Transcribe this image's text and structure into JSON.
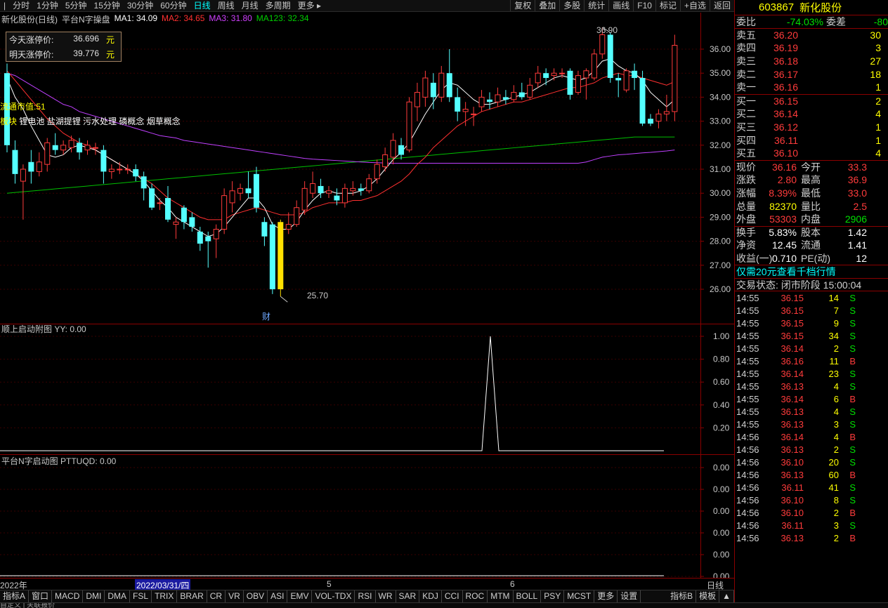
{
  "toolbar": {
    "left_items": [
      "分时",
      "1分钟",
      "5分钟",
      "15分钟",
      "30分钟",
      "60分钟",
      "日线",
      "周线",
      "月线",
      "多周期",
      "更多 ▸"
    ],
    "active_index": 6,
    "right_items": [
      "复权",
      "叠加",
      "多股",
      "统计",
      "画线",
      "F10",
      "标记",
      "+自选",
      "返回"
    ]
  },
  "legend": {
    "stock": "新化股份(日线)",
    "indicator": "平台N字操盘",
    "ma1": "MA1: 34.09",
    "ma2": "MA2: 34.65",
    "ma3": "MA3: 31.80",
    "ma123": "MA123: 32.34"
  },
  "limitbox": {
    "today_label": "今天涨停价:",
    "today_value": "36.696",
    "today_unit": "元",
    "tomorrow_label": "明天涨停价:",
    "tomorrow_value": "39.776",
    "tomorrow_unit": "元"
  },
  "overlay": {
    "market_cap": "流通市值:51",
    "sectors_label": "板块",
    "sectors": "锂电池 盐湖提锂 污水处理 磷概念 烟草概念",
    "high_label": "36.90",
    "low_label": "25.70",
    "cai_label": "财"
  },
  "main_axis": [
    "36.00",
    "35.00",
    "34.00",
    "33.00",
    "32.00",
    "31.00",
    "30.00",
    "29.00",
    "28.00",
    "27.00",
    "26.00"
  ],
  "sub1": {
    "title": "顺上启动附图 YY: 0.00",
    "axis": [
      "1.00",
      "0.80",
      "0.60",
      "0.40",
      "0.20"
    ]
  },
  "sub2": {
    "title": "平台N字启动图 PTTUQD: 0.00",
    "axis": [
      "0.00",
      "0.00",
      "0.00",
      "0.00",
      "0.00",
      "0.00"
    ]
  },
  "datebar": {
    "year": "2022年",
    "selected": "2022/03/31/四",
    "m5": "5",
    "m6": "6",
    "period": "日线"
  },
  "tabs": [
    "指标A",
    "窗口",
    "MACD",
    "DMI",
    "DMA",
    "FSL",
    "TRIX",
    "BRAR",
    "CR",
    "VR",
    "OBV",
    "ASI",
    "EMV",
    "VOL-TDX",
    "RSI",
    "WR",
    "SAR",
    "KDJ",
    "CCI",
    "ROC",
    "MTM",
    "BOLL",
    "PSY",
    "MCST",
    "更多",
    "设置"
  ],
  "tabs_right": [
    "指标B",
    "模板",
    "▲"
  ],
  "bottom_strip": "自定义 | 关联报价",
  "quote": {
    "code": "603867",
    "name": "新化股份",
    "wb_label": "委比",
    "wb_value": "-74.03%",
    "wc_label": "委差",
    "wc_value": "-80",
    "asks": [
      {
        "label": "卖五",
        "price": "36.20",
        "vol": "30"
      },
      {
        "label": "卖四",
        "price": "36.19",
        "vol": "3"
      },
      {
        "label": "卖三",
        "price": "36.18",
        "vol": "27"
      },
      {
        "label": "卖二",
        "price": "36.17",
        "vol": "18"
      },
      {
        "label": "卖一",
        "price": "36.16",
        "vol": "1"
      }
    ],
    "bids": [
      {
        "label": "买一",
        "price": "36.15",
        "vol": "2"
      },
      {
        "label": "买二",
        "price": "36.14",
        "vol": "4"
      },
      {
        "label": "买三",
        "price": "36.12",
        "vol": "1"
      },
      {
        "label": "买四",
        "price": "36.11",
        "vol": "1"
      },
      {
        "label": "买五",
        "price": "36.10",
        "vol": "4"
      }
    ],
    "stats": [
      {
        "l1": "现价",
        "v1": "36.16",
        "c1": "red",
        "l2": "今开",
        "v2": "33.3",
        "c2": "red"
      },
      {
        "l1": "涨跌",
        "v1": "2.80",
        "c1": "red",
        "l2": "最高",
        "v2": "36.9",
        "c2": "red"
      },
      {
        "l1": "涨幅",
        "v1": "8.39%",
        "c1": "red",
        "l2": "最低",
        "v2": "33.0",
        "c2": "red"
      },
      {
        "l1": "总量",
        "v1": "82370",
        "c1": "yellow",
        "l2": "量比",
        "v2": "2.5",
        "c2": "red"
      },
      {
        "l1": "外盘",
        "v1": "53303",
        "c1": "red",
        "l2": "内盘",
        "v2": "2906",
        "c2": "green"
      },
      {
        "l1": "换手",
        "v1": "5.83%",
        "c1": "white",
        "l2": "股本",
        "v2": "1.42",
        "c2": "white"
      },
      {
        "l1": "净资",
        "v1": "12.45",
        "c1": "white",
        "l2": "流通",
        "v2": "1.41",
        "c2": "white"
      },
      {
        "l1": "收益(一)",
        "v1": "0.710",
        "c1": "white",
        "l2": "PE(动)",
        "v2": "12",
        "c2": "white"
      }
    ],
    "promo": "仅需20元查看千档行情",
    "status": "交易状态: 闭市阶段 15:00:04",
    "ticks": [
      {
        "t": "14:55",
        "p": "36.15",
        "v": "14",
        "d": "S"
      },
      {
        "t": "14:55",
        "p": "36.15",
        "v": "7",
        "d": "S"
      },
      {
        "t": "14:55",
        "p": "36.15",
        "v": "9",
        "d": "S"
      },
      {
        "t": "14:55",
        "p": "36.15",
        "v": "34",
        "d": "S"
      },
      {
        "t": "14:55",
        "p": "36.14",
        "v": "2",
        "d": "S"
      },
      {
        "t": "14:55",
        "p": "36.16",
        "v": "11",
        "d": "B"
      },
      {
        "t": "14:55",
        "p": "36.14",
        "v": "23",
        "d": "S"
      },
      {
        "t": "14:55",
        "p": "36.13",
        "v": "4",
        "d": "S"
      },
      {
        "t": "14:55",
        "p": "36.14",
        "v": "6",
        "d": "B"
      },
      {
        "t": "14:55",
        "p": "36.13",
        "v": "4",
        "d": "S"
      },
      {
        "t": "14:55",
        "p": "36.13",
        "v": "3",
        "d": "S"
      },
      {
        "t": "14:56",
        "p": "36.14",
        "v": "4",
        "d": "B"
      },
      {
        "t": "14:56",
        "p": "36.13",
        "v": "2",
        "d": "S"
      },
      {
        "t": "14:56",
        "p": "36.10",
        "v": "20",
        "d": "S"
      },
      {
        "t": "14:56",
        "p": "36.13",
        "v": "60",
        "d": "B"
      },
      {
        "t": "14:56",
        "p": "36.11",
        "v": "41",
        "d": "S"
      },
      {
        "t": "14:56",
        "p": "36.10",
        "v": "8",
        "d": "S"
      },
      {
        "t": "14:56",
        "p": "36.10",
        "v": "2",
        "d": "B"
      },
      {
        "t": "14:56",
        "p": "36.11",
        "v": "3",
        "d": "S"
      },
      {
        "t": "14:56",
        "p": "36.13",
        "v": "2",
        "d": "B"
      }
    ]
  },
  "colors": {
    "up": "#ff3b3b",
    "down": "#54ffff",
    "ma1": "#ffffff",
    "ma2": "#ff3030",
    "ma3": "#c040ff",
    "ma123": "#00c000",
    "highlight": "#ffe000",
    "frame": "#8b0000"
  },
  "chart_data": {
    "type": "candlestick",
    "candles": [
      {
        "o": 35.0,
        "c": 32.0,
        "h": 35.4,
        "l": 31.7
      },
      {
        "o": 31.8,
        "c": 30.8,
        "h": 32.2,
        "l": 30.4
      },
      {
        "o": 30.5,
        "c": 31.0,
        "h": 31.2,
        "l": 28.9
      },
      {
        "o": 31.3,
        "c": 30.9,
        "h": 31.8,
        "l": 30.4
      },
      {
        "o": 30.9,
        "c": 31.3,
        "h": 31.7,
        "l": 30.7
      },
      {
        "o": 31.2,
        "c": 32.1,
        "h": 32.3,
        "l": 30.9
      },
      {
        "o": 32.0,
        "c": 31.8,
        "h": 32.5,
        "l": 31.6
      },
      {
        "o": 31.8,
        "c": 32.0,
        "h": 32.2,
        "l": 31.6
      },
      {
        "o": 31.9,
        "c": 32.2,
        "h": 32.4,
        "l": 31.7
      },
      {
        "o": 32.1,
        "c": 31.7,
        "h": 32.3,
        "l": 31.4
      },
      {
        "o": 31.8,
        "c": 32.0,
        "h": 32.2,
        "l": 31.6
      },
      {
        "o": 31.9,
        "c": 31.9,
        "h": 32.1,
        "l": 31.6
      },
      {
        "o": 31.8,
        "c": 30.9,
        "h": 32.0,
        "l": 30.4
      },
      {
        "o": 30.9,
        "c": 31.0,
        "h": 31.2,
        "l": 30.6
      },
      {
        "o": 31.0,
        "c": 31.0,
        "h": 31.3,
        "l": 30.8
      },
      {
        "o": 31.0,
        "c": 31.0,
        "h": 31.2,
        "l": 30.8
      },
      {
        "o": 31.0,
        "c": 30.7,
        "h": 31.2,
        "l": 30.5
      },
      {
        "o": 30.7,
        "c": 30.2,
        "h": 30.9,
        "l": 29.7
      },
      {
        "o": 30.2,
        "c": 29.4,
        "h": 30.4,
        "l": 29.3
      },
      {
        "o": 29.6,
        "c": 29.6,
        "h": 29.8,
        "l": 29.3
      },
      {
        "o": 29.8,
        "c": 28.9,
        "h": 30.3,
        "l": 28.8
      },
      {
        "o": 28.7,
        "c": 28.8,
        "h": 29.0,
        "l": 28.1
      },
      {
        "o": 29.4,
        "c": 28.8,
        "h": 29.5,
        "l": 28.5
      },
      {
        "o": 29.0,
        "c": 28.6,
        "h": 29.2,
        "l": 28.4
      },
      {
        "o": 28.4,
        "c": 27.9,
        "h": 28.6,
        "l": 27.6
      },
      {
        "o": 28.2,
        "c": 28.0,
        "h": 28.4,
        "l": 26.9
      },
      {
        "o": 28.1,
        "c": 28.5,
        "h": 28.7,
        "l": 27.3
      },
      {
        "o": 28.5,
        "c": 29.9,
        "h": 30.2,
        "l": 28.3
      },
      {
        "o": 29.6,
        "c": 30.1,
        "h": 30.5,
        "l": 29.2
      },
      {
        "o": 30.0,
        "c": 30.2,
        "h": 30.4,
        "l": 29.7
      },
      {
        "o": 30.2,
        "c": 30.0,
        "h": 30.9,
        "l": 29.8
      },
      {
        "o": 30.8,
        "c": 29.4,
        "h": 31.1,
        "l": 29.2
      },
      {
        "o": 28.8,
        "c": 28.2,
        "h": 29.0,
        "l": 27.8
      },
      {
        "o": 28.7,
        "c": 26.0,
        "h": 28.8,
        "l": 25.8
      },
      {
        "o": 26.0,
        "c": 28.8,
        "h": 28.9,
        "l": 25.7,
        "hl": true
      },
      {
        "o": 28.5,
        "c": 28.7,
        "h": 29.2,
        "l": 28.3
      },
      {
        "o": 28.7,
        "c": 29.4,
        "h": 29.7,
        "l": 28.6
      },
      {
        "o": 29.3,
        "c": 30.2,
        "h": 30.5,
        "l": 29.1
      },
      {
        "o": 30.0,
        "c": 30.4,
        "h": 30.9,
        "l": 29.8
      },
      {
        "o": 30.3,
        "c": 30.0,
        "h": 30.6,
        "l": 29.8
      },
      {
        "o": 30.0,
        "c": 30.1,
        "h": 30.3,
        "l": 29.8
      },
      {
        "o": 29.9,
        "c": 29.7,
        "h": 30.2,
        "l": 29.5
      },
      {
        "o": 29.6,
        "c": 30.2,
        "h": 30.4,
        "l": 29.4
      },
      {
        "o": 30.1,
        "c": 30.2,
        "h": 30.5,
        "l": 29.9
      },
      {
        "o": 30.2,
        "c": 30.1,
        "h": 30.4,
        "l": 29.9
      },
      {
        "o": 30.1,
        "c": 30.6,
        "h": 30.8,
        "l": 30.0
      },
      {
        "o": 30.6,
        "c": 31.2,
        "h": 31.4,
        "l": 30.4
      },
      {
        "o": 31.1,
        "c": 31.6,
        "h": 31.9,
        "l": 30.9
      },
      {
        "o": 31.5,
        "c": 32.2,
        "h": 32.5,
        "l": 31.2
      },
      {
        "o": 32.0,
        "c": 31.6,
        "h": 32.3,
        "l": 31.4
      },
      {
        "o": 31.8,
        "c": 33.8,
        "h": 34.0,
        "l": 31.7
      },
      {
        "o": 33.6,
        "c": 34.2,
        "h": 34.6,
        "l": 33.0
      },
      {
        "o": 34.0,
        "c": 34.8,
        "h": 35.1,
        "l": 33.6
      },
      {
        "o": 34.6,
        "c": 34.0,
        "h": 35.0,
        "l": 33.5
      },
      {
        "o": 34.0,
        "c": 35.0,
        "h": 35.3,
        "l": 33.8
      },
      {
        "o": 35.0,
        "c": 34.0,
        "h": 36.0,
        "l": 33.8
      },
      {
        "o": 34.0,
        "c": 33.4,
        "h": 34.4,
        "l": 33.0
      },
      {
        "o": 33.4,
        "c": 33.5,
        "h": 33.8,
        "l": 32.8
      },
      {
        "o": 33.3,
        "c": 33.3,
        "h": 33.6,
        "l": 32.8
      },
      {
        "o": 33.6,
        "c": 34.0,
        "h": 34.3,
        "l": 33.4
      },
      {
        "o": 33.9,
        "c": 33.8,
        "h": 34.2,
        "l": 33.5
      },
      {
        "o": 33.8,
        "c": 34.1,
        "h": 34.4,
        "l": 33.6
      },
      {
        "o": 34.0,
        "c": 33.9,
        "h": 34.3,
        "l": 33.7
      },
      {
        "o": 33.9,
        "c": 34.2,
        "h": 34.5,
        "l": 33.8
      },
      {
        "o": 34.2,
        "c": 34.0,
        "h": 34.6,
        "l": 33.9
      },
      {
        "o": 34.0,
        "c": 34.5,
        "h": 34.8,
        "l": 33.9
      },
      {
        "o": 34.6,
        "c": 35.0,
        "h": 35.3,
        "l": 34.4
      },
      {
        "o": 35.0,
        "c": 34.8,
        "h": 35.2,
        "l": 34.5
      },
      {
        "o": 34.9,
        "c": 35.0,
        "h": 35.2,
        "l": 34.7
      },
      {
        "o": 35.0,
        "c": 35.0,
        "h": 35.2,
        "l": 34.8
      },
      {
        "o": 35.1,
        "c": 34.1,
        "h": 35.2,
        "l": 33.9
      },
      {
        "o": 34.2,
        "c": 34.9,
        "h": 35.1,
        "l": 34.1
      },
      {
        "o": 34.8,
        "c": 35.1,
        "h": 35.2,
        "l": 33.9
      },
      {
        "o": 34.8,
        "c": 35.8,
        "h": 36.0,
        "l": 34.7
      },
      {
        "o": 35.8,
        "c": 36.6,
        "h": 36.9,
        "l": 35.6
      },
      {
        "o": 36.6,
        "c": 34.8,
        "h": 36.7,
        "l": 34.6
      },
      {
        "o": 34.8,
        "c": 34.7,
        "h": 35.0,
        "l": 34.0
      },
      {
        "o": 34.3,
        "c": 35.1,
        "h": 35.2,
        "l": 34.2
      },
      {
        "o": 35.1,
        "c": 34.8,
        "h": 35.4,
        "l": 34.3
      },
      {
        "o": 34.8,
        "c": 32.9,
        "h": 35.1,
        "l": 32.8
      },
      {
        "o": 33.1,
        "c": 32.9,
        "h": 33.3,
        "l": 32.8
      },
      {
        "o": 33.0,
        "c": 33.3,
        "h": 33.5,
        "l": 32.7
      },
      {
        "o": 33.3,
        "c": 33.4,
        "h": 34.1,
        "l": 33.0
      },
      {
        "o": 33.4,
        "c": 36.16,
        "h": 36.6,
        "l": 33.0
      }
    ],
    "ma1": [
      34.8,
      34.0,
      33.5,
      32.8,
      32.2,
      31.6,
      31.5,
      31.6,
      31.9,
      32.0,
      31.9,
      31.8,
      31.6,
      31.4,
      31.2,
      31.0,
      30.8,
      30.5,
      30.1,
      29.7,
      29.4,
      29.0,
      28.8,
      28.6,
      28.4,
      28.2,
      28.3,
      28.6,
      29.0,
      29.4,
      29.8,
      29.8,
      29.4,
      28.7,
      28.5,
      28.5,
      28.8,
      29.3,
      29.7,
      30.0,
      30.1,
      30.0,
      30.0,
      30.0,
      30.1,
      30.3,
      30.6,
      31.0,
      31.4,
      31.7,
      32.1,
      32.7,
      33.3,
      33.8,
      34.3,
      34.6,
      34.5,
      34.2,
      33.9,
      33.7,
      33.7,
      33.8,
      33.9,
      34.0,
      34.1,
      34.2,
      34.4,
      34.6,
      34.8,
      34.9,
      34.8,
      34.7,
      34.8,
      35.1,
      35.5,
      35.6,
      35.3,
      35.1,
      35.0,
      34.7,
      34.2,
      33.9,
      33.6,
      33.9
    ],
    "ma2": [
      35.1,
      34.7,
      34.3,
      33.9,
      33.5,
      33.1,
      32.8,
      32.5,
      32.3,
      32.1,
      32.0,
      31.8,
      31.6,
      31.4,
      31.2,
      31.0,
      30.8,
      30.6,
      30.4,
      30.1,
      29.8,
      29.6,
      29.4,
      29.2,
      29.0,
      28.9,
      28.9,
      28.9,
      29.1,
      29.2,
      29.3,
      29.4,
      29.3,
      29.2,
      29.1,
      29.1,
      29.1,
      29.2,
      29.4,
      29.5,
      29.6,
      29.6,
      29.6,
      29.7,
      29.7,
      29.8,
      29.9,
      30.1,
      30.3,
      30.5,
      30.8,
      31.2,
      31.5,
      31.9,
      32.2,
      32.5,
      32.8,
      33.0,
      33.2,
      33.4,
      33.5,
      33.6,
      33.7,
      33.8,
      33.8,
      33.9,
      34.0,
      34.1,
      34.2,
      34.3,
      34.4,
      34.4,
      34.5,
      34.6,
      34.8,
      34.9,
      35.0,
      34.9,
      34.9,
      34.8,
      34.7,
      34.6,
      34.5,
      34.65
    ],
    "ma3": [
      35.0,
      34.9,
      34.7,
      34.5,
      34.3,
      34.1,
      33.9,
      33.7,
      33.6,
      33.4,
      33.3,
      33.2,
      33.1,
      33.0,
      32.9,
      32.8,
      32.7,
      32.6,
      32.5,
      32.4,
      32.35,
      32.3,
      32.2,
      32.15,
      32.1,
      32.05,
      32.0,
      31.95,
      31.9,
      31.85,
      31.8,
      31.75,
      31.7,
      31.65,
      31.6,
      31.55,
      31.5,
      31.45,
      31.42,
      31.4,
      31.38,
      31.36,
      31.34,
      31.32,
      31.3,
      31.28,
      31.27,
      31.26,
      31.25,
      31.25,
      31.25,
      31.25,
      31.25,
      31.25,
      31.25,
      31.25,
      31.25,
      31.25,
      31.25,
      31.25,
      31.25,
      31.25,
      31.25,
      31.25,
      31.25,
      31.25,
      31.25,
      31.25,
      31.25,
      31.25,
      31.25,
      31.25,
      31.3,
      31.4,
      31.5,
      31.55,
      31.6,
      31.62,
      31.65,
      31.68,
      31.7,
      31.73,
      31.76,
      31.8
    ],
    "ma123": [
      30.0,
      30.03,
      30.06,
      30.09,
      30.12,
      30.15,
      30.18,
      30.21,
      30.24,
      30.27,
      30.3,
      30.33,
      30.36,
      30.39,
      30.42,
      30.45,
      30.48,
      30.51,
      30.54,
      30.57,
      30.6,
      30.63,
      30.66,
      30.69,
      30.72,
      30.75,
      30.78,
      30.81,
      30.84,
      30.87,
      30.9,
      30.93,
      30.96,
      30.99,
      31.02,
      31.05,
      31.08,
      31.11,
      31.14,
      31.17,
      31.2,
      31.23,
      31.26,
      31.29,
      31.32,
      31.35,
      31.38,
      31.41,
      31.44,
      31.47,
      31.5,
      31.53,
      31.56,
      31.59,
      31.62,
      31.65,
      31.68,
      31.71,
      31.74,
      31.77,
      31.8,
      31.83,
      31.86,
      31.89,
      31.92,
      31.95,
      31.98,
      32.01,
      32.04,
      32.07,
      32.1,
      32.13,
      32.16,
      32.19,
      32.22,
      32.25,
      32.28,
      32.31,
      32.34,
      32.34,
      32.34,
      32.34,
      32.34,
      32.34
    ],
    "yy": {
      "spike_index": 60,
      "values_note": "0 everywhere except 1 at spike"
    },
    "ylim": [
      25.5,
      37.0
    ]
  }
}
